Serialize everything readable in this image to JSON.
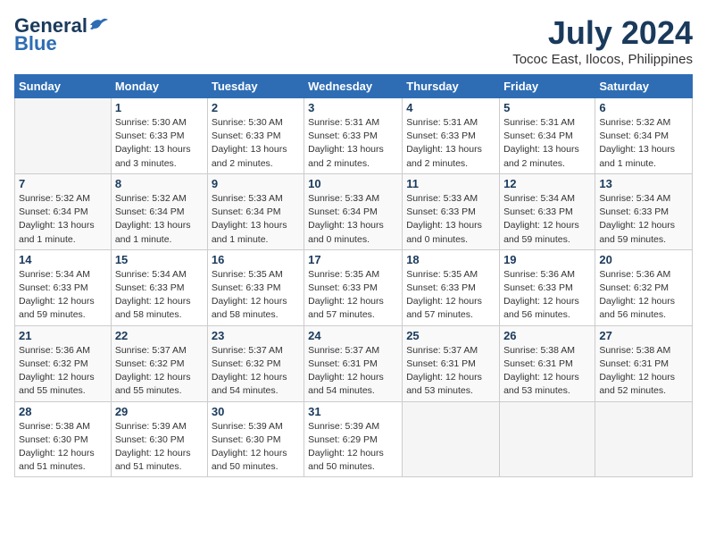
{
  "header": {
    "logo_general": "General",
    "logo_blue": "Blue",
    "month_year": "July 2024",
    "location": "Tococ East, Ilocos, Philippines"
  },
  "days_of_week": [
    "Sunday",
    "Monday",
    "Tuesday",
    "Wednesday",
    "Thursday",
    "Friday",
    "Saturday"
  ],
  "weeks": [
    [
      {
        "num": "",
        "sunrise": "",
        "sunset": "",
        "daylight": ""
      },
      {
        "num": "1",
        "sunrise": "Sunrise: 5:30 AM",
        "sunset": "Sunset: 6:33 PM",
        "daylight": "Daylight: 13 hours and 3 minutes."
      },
      {
        "num": "2",
        "sunrise": "Sunrise: 5:30 AM",
        "sunset": "Sunset: 6:33 PM",
        "daylight": "Daylight: 13 hours and 2 minutes."
      },
      {
        "num": "3",
        "sunrise": "Sunrise: 5:31 AM",
        "sunset": "Sunset: 6:33 PM",
        "daylight": "Daylight: 13 hours and 2 minutes."
      },
      {
        "num": "4",
        "sunrise": "Sunrise: 5:31 AM",
        "sunset": "Sunset: 6:33 PM",
        "daylight": "Daylight: 13 hours and 2 minutes."
      },
      {
        "num": "5",
        "sunrise": "Sunrise: 5:31 AM",
        "sunset": "Sunset: 6:34 PM",
        "daylight": "Daylight: 13 hours and 2 minutes."
      },
      {
        "num": "6",
        "sunrise": "Sunrise: 5:32 AM",
        "sunset": "Sunset: 6:34 PM",
        "daylight": "Daylight: 13 hours and 1 minute."
      }
    ],
    [
      {
        "num": "7",
        "sunrise": "Sunrise: 5:32 AM",
        "sunset": "Sunset: 6:34 PM",
        "daylight": "Daylight: 13 hours and 1 minute."
      },
      {
        "num": "8",
        "sunrise": "Sunrise: 5:32 AM",
        "sunset": "Sunset: 6:34 PM",
        "daylight": "Daylight: 13 hours and 1 minute."
      },
      {
        "num": "9",
        "sunrise": "Sunrise: 5:33 AM",
        "sunset": "Sunset: 6:34 PM",
        "daylight": "Daylight: 13 hours and 1 minute."
      },
      {
        "num": "10",
        "sunrise": "Sunrise: 5:33 AM",
        "sunset": "Sunset: 6:34 PM",
        "daylight": "Daylight: 13 hours and 0 minutes."
      },
      {
        "num": "11",
        "sunrise": "Sunrise: 5:33 AM",
        "sunset": "Sunset: 6:33 PM",
        "daylight": "Daylight: 13 hours and 0 minutes."
      },
      {
        "num": "12",
        "sunrise": "Sunrise: 5:34 AM",
        "sunset": "Sunset: 6:33 PM",
        "daylight": "Daylight: 12 hours and 59 minutes."
      },
      {
        "num": "13",
        "sunrise": "Sunrise: 5:34 AM",
        "sunset": "Sunset: 6:33 PM",
        "daylight": "Daylight: 12 hours and 59 minutes."
      }
    ],
    [
      {
        "num": "14",
        "sunrise": "Sunrise: 5:34 AM",
        "sunset": "Sunset: 6:33 PM",
        "daylight": "Daylight: 12 hours and 59 minutes."
      },
      {
        "num": "15",
        "sunrise": "Sunrise: 5:34 AM",
        "sunset": "Sunset: 6:33 PM",
        "daylight": "Daylight: 12 hours and 58 minutes."
      },
      {
        "num": "16",
        "sunrise": "Sunrise: 5:35 AM",
        "sunset": "Sunset: 6:33 PM",
        "daylight": "Daylight: 12 hours and 58 minutes."
      },
      {
        "num": "17",
        "sunrise": "Sunrise: 5:35 AM",
        "sunset": "Sunset: 6:33 PM",
        "daylight": "Daylight: 12 hours and 57 minutes."
      },
      {
        "num": "18",
        "sunrise": "Sunrise: 5:35 AM",
        "sunset": "Sunset: 6:33 PM",
        "daylight": "Daylight: 12 hours and 57 minutes."
      },
      {
        "num": "19",
        "sunrise": "Sunrise: 5:36 AM",
        "sunset": "Sunset: 6:33 PM",
        "daylight": "Daylight: 12 hours and 56 minutes."
      },
      {
        "num": "20",
        "sunrise": "Sunrise: 5:36 AM",
        "sunset": "Sunset: 6:32 PM",
        "daylight": "Daylight: 12 hours and 56 minutes."
      }
    ],
    [
      {
        "num": "21",
        "sunrise": "Sunrise: 5:36 AM",
        "sunset": "Sunset: 6:32 PM",
        "daylight": "Daylight: 12 hours and 55 minutes."
      },
      {
        "num": "22",
        "sunrise": "Sunrise: 5:37 AM",
        "sunset": "Sunset: 6:32 PM",
        "daylight": "Daylight: 12 hours and 55 minutes."
      },
      {
        "num": "23",
        "sunrise": "Sunrise: 5:37 AM",
        "sunset": "Sunset: 6:32 PM",
        "daylight": "Daylight: 12 hours and 54 minutes."
      },
      {
        "num": "24",
        "sunrise": "Sunrise: 5:37 AM",
        "sunset": "Sunset: 6:31 PM",
        "daylight": "Daylight: 12 hours and 54 minutes."
      },
      {
        "num": "25",
        "sunrise": "Sunrise: 5:37 AM",
        "sunset": "Sunset: 6:31 PM",
        "daylight": "Daylight: 12 hours and 53 minutes."
      },
      {
        "num": "26",
        "sunrise": "Sunrise: 5:38 AM",
        "sunset": "Sunset: 6:31 PM",
        "daylight": "Daylight: 12 hours and 53 minutes."
      },
      {
        "num": "27",
        "sunrise": "Sunrise: 5:38 AM",
        "sunset": "Sunset: 6:31 PM",
        "daylight": "Daylight: 12 hours and 52 minutes."
      }
    ],
    [
      {
        "num": "28",
        "sunrise": "Sunrise: 5:38 AM",
        "sunset": "Sunset: 6:30 PM",
        "daylight": "Daylight: 12 hours and 51 minutes."
      },
      {
        "num": "29",
        "sunrise": "Sunrise: 5:39 AM",
        "sunset": "Sunset: 6:30 PM",
        "daylight": "Daylight: 12 hours and 51 minutes."
      },
      {
        "num": "30",
        "sunrise": "Sunrise: 5:39 AM",
        "sunset": "Sunset: 6:30 PM",
        "daylight": "Daylight: 12 hours and 50 minutes."
      },
      {
        "num": "31",
        "sunrise": "Sunrise: 5:39 AM",
        "sunset": "Sunset: 6:29 PM",
        "daylight": "Daylight: 12 hours and 50 minutes."
      },
      {
        "num": "",
        "sunrise": "",
        "sunset": "",
        "daylight": ""
      },
      {
        "num": "",
        "sunrise": "",
        "sunset": "",
        "daylight": ""
      },
      {
        "num": "",
        "sunrise": "",
        "sunset": "",
        "daylight": ""
      }
    ]
  ]
}
